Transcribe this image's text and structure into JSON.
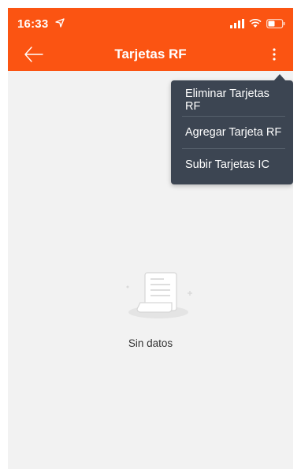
{
  "status_bar": {
    "time": "16:33"
  },
  "header": {
    "title": "Tarjetas RF"
  },
  "menu": {
    "items": [
      {
        "label": "Eliminar Tarjetas RF"
      },
      {
        "label": "Agregar Tarjeta RF"
      },
      {
        "label": "Subir Tarjetas IC"
      }
    ]
  },
  "empty_state": {
    "message": "Sin datos"
  },
  "colors": {
    "brand": "#fb5412",
    "menu_bg": "#3c4552",
    "page_bg": "#f2f2f2"
  }
}
